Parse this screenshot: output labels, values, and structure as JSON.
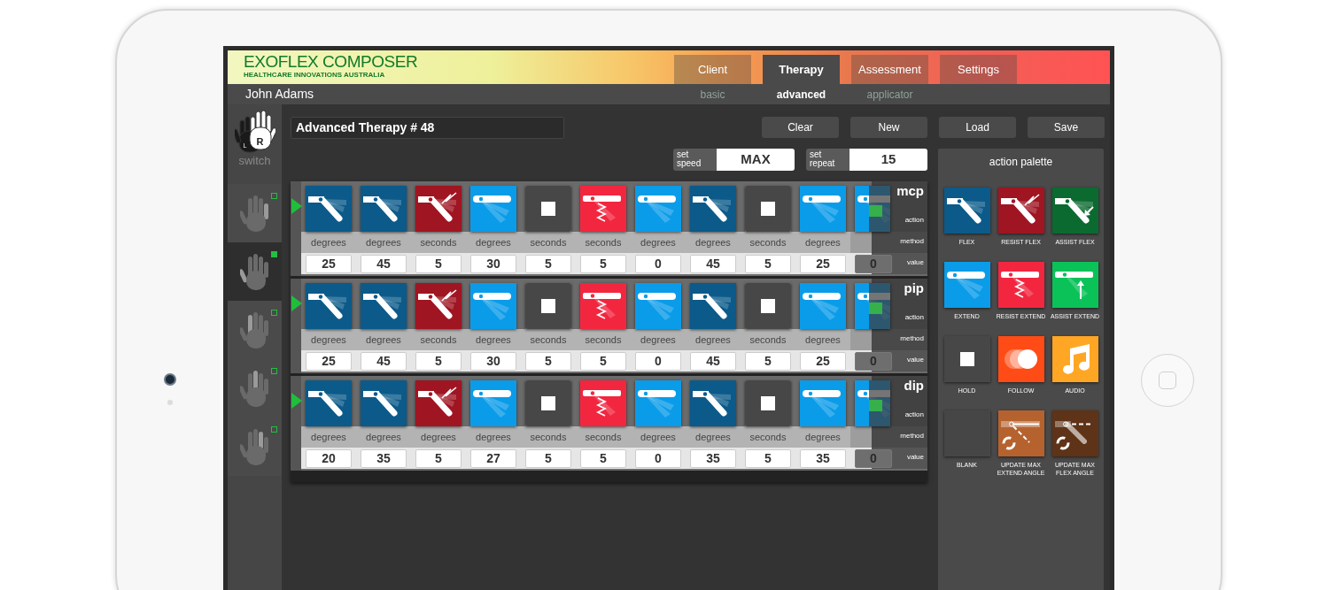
{
  "app": {
    "title": "EXOFLEX COMPOSER",
    "subtitle": "HEALTHCARE INNOVATIONS AUSTRALIA"
  },
  "tabs": [
    {
      "label": "Client",
      "selected": false
    },
    {
      "label": "Therapy",
      "selected": true
    },
    {
      "label": "Assessment",
      "selected": false
    },
    {
      "label": "Settings",
      "selected": false
    }
  ],
  "client_name": "John Adams",
  "subtabs": [
    {
      "label": "basic",
      "selected": false
    },
    {
      "label": "advanced",
      "selected": true
    },
    {
      "label": "applicator",
      "selected": false
    }
  ],
  "switch": {
    "left": {
      "label": "L",
      "selected": false
    },
    "right": {
      "label": "R",
      "selected": true
    },
    "label": "switch"
  },
  "fingers": [
    {
      "selected": false
    },
    {
      "selected": true
    },
    {
      "selected": false
    },
    {
      "selected": false
    },
    {
      "selected": false
    }
  ],
  "therapy_name": "Advanced Therapy # 48",
  "buttons": [
    "Clear",
    "New",
    "Load",
    "Save"
  ],
  "speed": {
    "label": "set speed",
    "value": "MAX"
  },
  "repeat": {
    "label": "set repeat",
    "value": "15"
  },
  "joints": [
    {
      "name": "mcp",
      "action_label": "action",
      "method_label": "method",
      "value_label": "value",
      "steps": [
        {
          "kind": "flex",
          "method": "degrees",
          "value": "25"
        },
        {
          "kind": "flex",
          "method": "degrees",
          "value": "45"
        },
        {
          "kind": "resist_flex",
          "method": "seconds",
          "value": "5"
        },
        {
          "kind": "extend",
          "method": "degrees",
          "value": "30"
        },
        {
          "kind": "hold",
          "method": "seconds",
          "value": "5"
        },
        {
          "kind": "resist_extend",
          "method": "seconds",
          "value": "5"
        },
        {
          "kind": "extend",
          "method": "degrees",
          "value": "0"
        },
        {
          "kind": "flex",
          "method": "degrees",
          "value": "45"
        },
        {
          "kind": "hold",
          "method": "seconds",
          "value": "5"
        },
        {
          "kind": "extend",
          "method": "degrees",
          "value": "25"
        },
        {
          "kind": "extend",
          "value": "0"
        }
      ]
    },
    {
      "name": "pip",
      "action_label": "action",
      "method_label": "method",
      "value_label": "value",
      "steps": [
        {
          "kind": "flex",
          "method": "degrees",
          "value": "25"
        },
        {
          "kind": "flex",
          "method": "degrees",
          "value": "45"
        },
        {
          "kind": "resist_flex",
          "method": "seconds",
          "value": "5"
        },
        {
          "kind": "extend",
          "method": "degrees",
          "value": "30"
        },
        {
          "kind": "hold",
          "method": "seconds",
          "value": "5"
        },
        {
          "kind": "resist_extend",
          "method": "seconds",
          "value": "5"
        },
        {
          "kind": "extend",
          "method": "degrees",
          "value": "0"
        },
        {
          "kind": "flex",
          "method": "degrees",
          "value": "45"
        },
        {
          "kind": "hold",
          "method": "seconds",
          "value": "5"
        },
        {
          "kind": "extend",
          "method": "degrees",
          "value": "25"
        },
        {
          "kind": "extend",
          "value": "0"
        }
      ]
    },
    {
      "name": "dip",
      "action_label": "action",
      "method_label": "method",
      "value_label": "value",
      "steps": [
        {
          "kind": "flex",
          "method": "degrees",
          "value": "20"
        },
        {
          "kind": "flex",
          "method": "degrees",
          "value": "35"
        },
        {
          "kind": "resist_flex",
          "method": "degrees",
          "value": "5"
        },
        {
          "kind": "extend",
          "method": "degrees",
          "value": "27"
        },
        {
          "kind": "hold",
          "method": "seconds",
          "value": "5"
        },
        {
          "kind": "resist_extend",
          "method": "seconds",
          "value": "5"
        },
        {
          "kind": "extend",
          "method": "degrees",
          "value": "0"
        },
        {
          "kind": "flex",
          "method": "degrees",
          "value": "35"
        },
        {
          "kind": "hold",
          "method": "seconds",
          "value": "5"
        },
        {
          "kind": "extend",
          "method": "degrees",
          "value": "35"
        },
        {
          "kind": "extend",
          "value": "0"
        }
      ]
    }
  ],
  "palette": {
    "title": "action palette",
    "items": [
      {
        "kind": "flex",
        "label": "FLEX"
      },
      {
        "kind": "resist_flex",
        "label": "RESIST FLEX"
      },
      {
        "kind": "assist_flex",
        "label": "ASSIST FLEX"
      },
      {
        "kind": "extend",
        "label": "EXTEND"
      },
      {
        "kind": "resist_extend",
        "label": "RESIST EXTEND"
      },
      {
        "kind": "assist_extend",
        "label": "ASSIST EXTEND"
      },
      {
        "kind": "hold",
        "label": "HOLD"
      },
      {
        "kind": "follow",
        "label": "FOLLOW"
      },
      {
        "kind": "audio",
        "label": "AUDIO"
      },
      {
        "kind": "blank",
        "label": "BLANK"
      },
      {
        "kind": "update_extend",
        "label": "UPDATE MAX EXTEND ANGLE"
      },
      {
        "kind": "update_flex",
        "label": "UPDATE MAX FLEX ANGLE"
      }
    ]
  }
}
